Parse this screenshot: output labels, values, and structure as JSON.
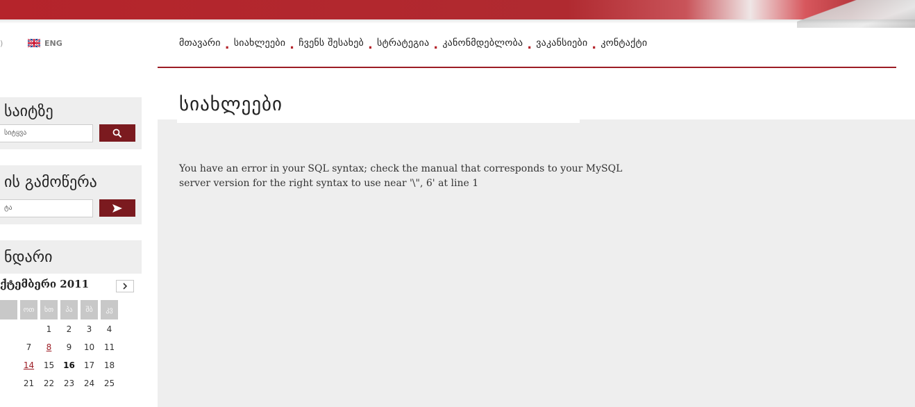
{
  "language": {
    "code": "ENG",
    "flag_icon": "uk-flag-icon"
  },
  "nav": {
    "items": [
      "მთავარი",
      "სიახლეები",
      "ჩვენს შესახებ",
      "სტრატეგია",
      "კანონმდებლობა",
      "ვაკანსიები",
      "კონტაქტი"
    ],
    "separator": "."
  },
  "page": {
    "title": "სიახლეები",
    "error_line1": "You have an error in your SQL syntax; check the manual that corresponds to your MySQL",
    "error_line2": "server version for the right syntax to use near '\\\", 6' at line 1"
  },
  "sidebar": {
    "search": {
      "title": "საიტზე",
      "placeholder": "სიტყვა",
      "icon": "search-icon"
    },
    "subscribe": {
      "title": "ის გამოწერა",
      "placeholder": "ტა",
      "icon": "arrow-right-icon"
    },
    "calendar": {
      "title": "ნდარი",
      "month_label": "ქტემბერი 2011",
      "next_icon": "chevron-right-icon",
      "weekdays": [
        "",
        "ოთ",
        "ხთ",
        "პა",
        "შბ",
        "კვ"
      ],
      "rows": [
        [
          "",
          "",
          "1",
          "2",
          "3",
          "4"
        ],
        [
          "",
          "7",
          "8",
          "9",
          "10",
          "11"
        ],
        [
          "",
          "14",
          "15",
          "16",
          "17",
          "18"
        ],
        [
          "",
          "21",
          "22",
          "23",
          "24",
          "25"
        ]
      ],
      "linked_days": [
        "8",
        "14"
      ],
      "today": "16"
    }
  },
  "colors": {
    "brand_red": "#9c1c24",
    "button_red": "#7b1a1f",
    "panel_gray": "#eeeeee"
  }
}
